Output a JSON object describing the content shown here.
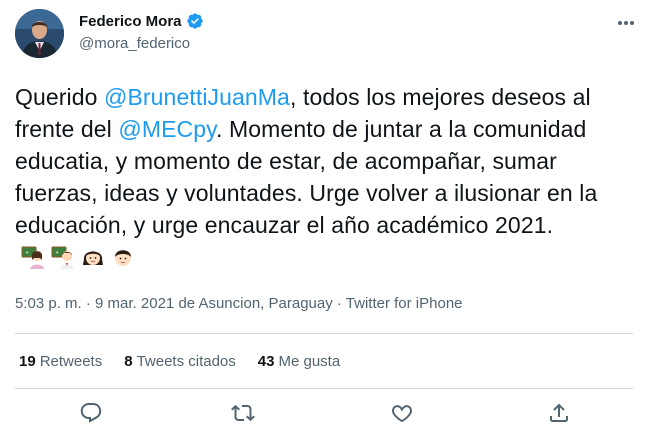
{
  "author": {
    "display_name": "Federico Mora",
    "handle": "@mora_federico",
    "verified": true
  },
  "tweet": {
    "segments": [
      {
        "type": "text",
        "value": "Querido "
      },
      {
        "type": "mention",
        "value": "@BrunettiJuanMa"
      },
      {
        "type": "text",
        "value": ", todos los mejores deseos al frente del "
      },
      {
        "type": "mention",
        "value": "@MECpy"
      },
      {
        "type": "text",
        "value": ". Momento de juntar a la comunidad educatia, y momento de estar, de acompañar, sumar fuerzas, ideas y voluntades. Urge volver a ilusionar en la educación, y urge encauzar el año académico 2021."
      }
    ],
    "emojis": [
      "woman-teacher-emoji",
      "man-teacher-emoji",
      "girl-emoji",
      "boy-emoji"
    ]
  },
  "meta": {
    "time": "5:03 p. m.",
    "date": "9 mar. 2021",
    "location": "de Asuncion, Paraguay",
    "source": "Twitter for iPhone",
    "separator": "·"
  },
  "stats": {
    "retweets_count": "19",
    "retweets_label": "Retweets",
    "quotes_count": "8",
    "quotes_label": "Tweets citados",
    "likes_count": "43",
    "likes_label": "Me gusta"
  },
  "actions": [
    "reply-icon",
    "retweet-icon",
    "like-icon",
    "share-icon"
  ],
  "colors": {
    "link": "#1d9bf0",
    "text": "#0f1419",
    "secondary": "#536471",
    "divider": "#cfd9de"
  }
}
